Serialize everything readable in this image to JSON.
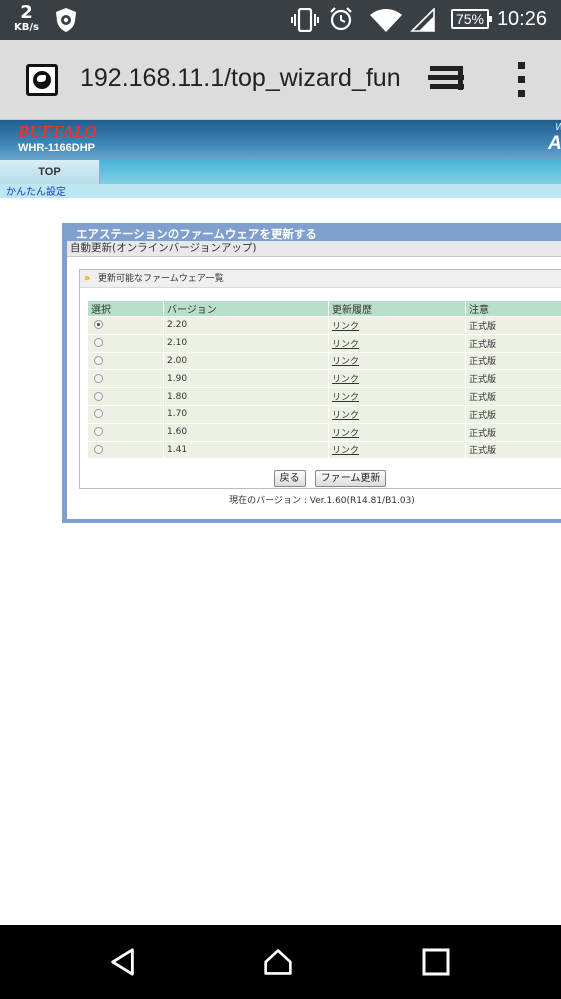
{
  "status_bar": {
    "net_speed": "2",
    "net_unit": "KB/s",
    "battery": "75%",
    "time": "10:26"
  },
  "browser": {
    "url": "192.168.11.1/top_wizard_func"
  },
  "router": {
    "brand": "BUFFALO",
    "model": "WHR-1166DHP",
    "brand_right_top": "W",
    "brand_right": "Ai",
    "nav_tab": "TOP",
    "sub_link": "かんたん設定"
  },
  "panel": {
    "title": "エアステーションのファームウェアを更新する",
    "section": "自動更新(オンラインバージョンアップ)",
    "list_title": "更新可能なファームウェア一覧",
    "columns": [
      "選択",
      "バージョン",
      "更新履歴",
      "注意"
    ],
    "rows": [
      {
        "version": "2.20",
        "history": "リンク",
        "note": "正式版",
        "selected": true
      },
      {
        "version": "2.10",
        "history": "リンク",
        "note": "正式版",
        "selected": false
      },
      {
        "version": "2.00",
        "history": "リンク",
        "note": "正式版",
        "selected": false
      },
      {
        "version": "1.90",
        "history": "リンク",
        "note": "正式版",
        "selected": false
      },
      {
        "version": "1.80",
        "history": "リンク",
        "note": "正式版",
        "selected": false
      },
      {
        "version": "1.70",
        "history": "リンク",
        "note": "正式版",
        "selected": false
      },
      {
        "version": "1.60",
        "history": "リンク",
        "note": "正式版",
        "selected": false
      },
      {
        "version": "1.41",
        "history": "リンク",
        "note": "正式版",
        "selected": false
      }
    ],
    "back_button": "戻る",
    "update_button": "ファーム更新",
    "current_version": "現在のバージョン : Ver.1.60(R14.81/B1.03)"
  }
}
